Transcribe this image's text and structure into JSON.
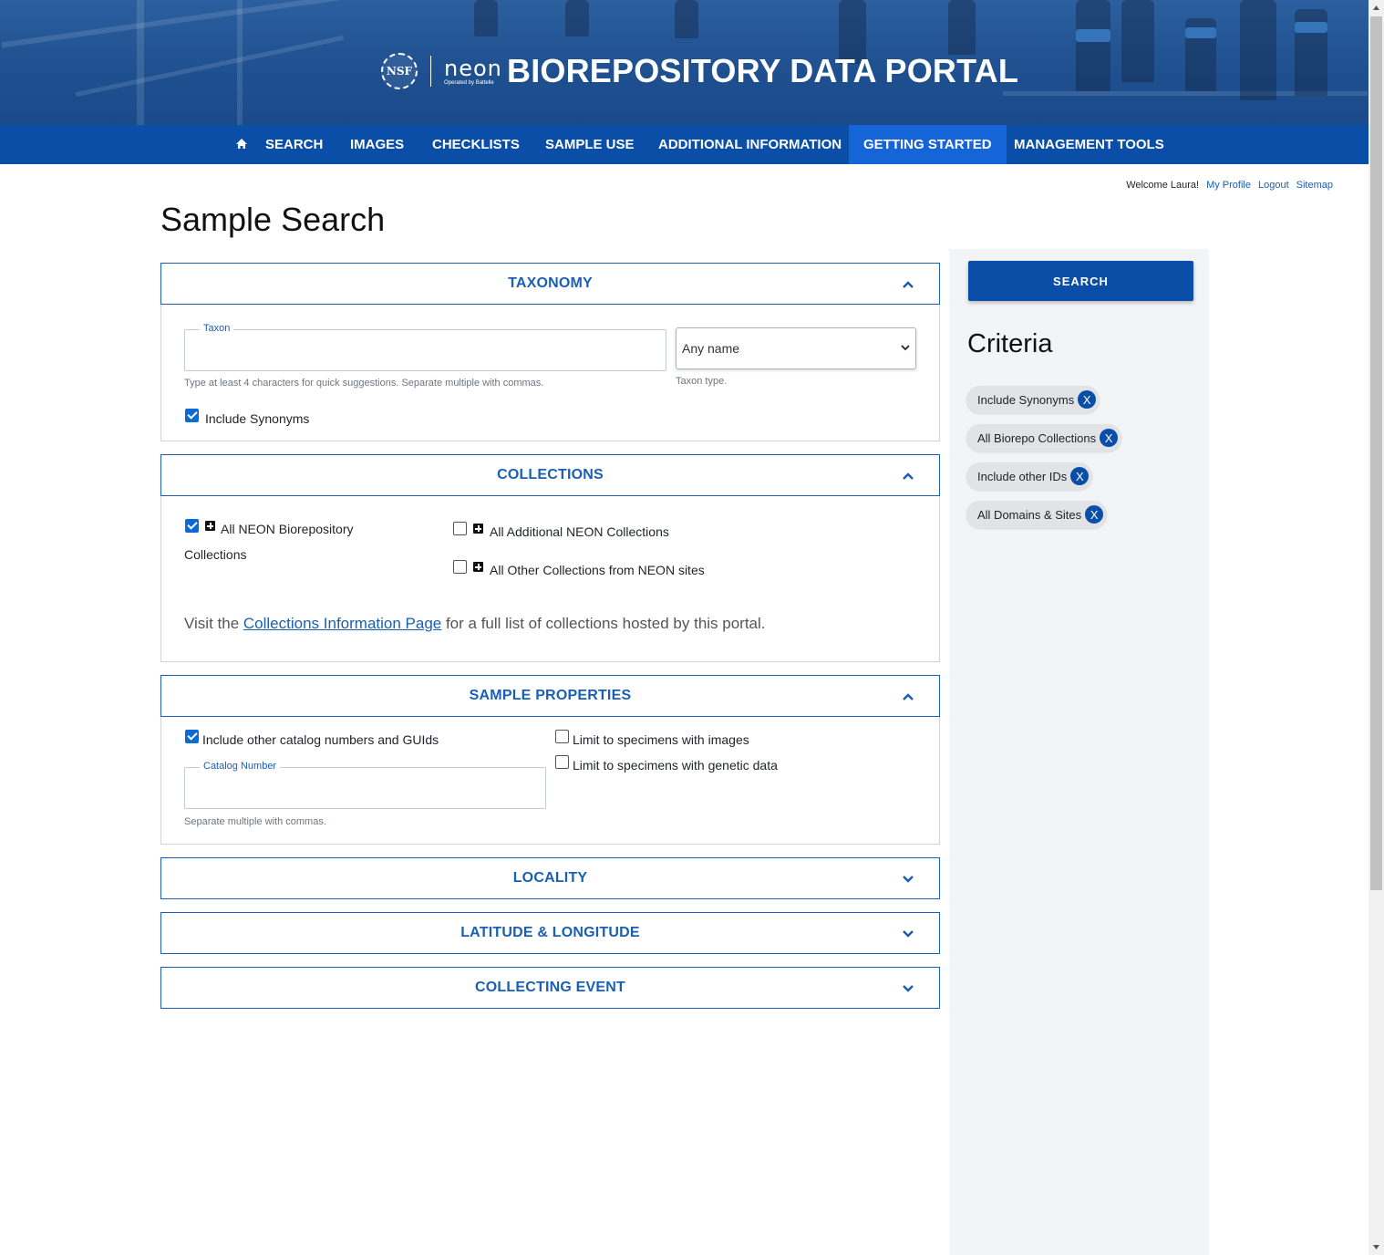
{
  "header": {
    "nsf_logo_text": "NSF",
    "neon_logo_text": "neon",
    "neon_logo_sub": "Operated by Battelle",
    "title": "BIOREPOSITORY DATA PORTAL"
  },
  "nav": {
    "home_icon": "home-icon",
    "items": [
      {
        "label": "SEARCH"
      },
      {
        "label": "IMAGES"
      },
      {
        "label": "CHECKLISTS"
      },
      {
        "label": "SAMPLE USE"
      },
      {
        "label": "ADDITIONAL INFORMATION"
      },
      {
        "label": "GETTING STARTED",
        "active": true
      },
      {
        "label": "MANAGEMENT TOOLS"
      }
    ]
  },
  "user": {
    "welcome": "Welcome Laura!",
    "profile": "My Profile",
    "logout": "Logout",
    "sitemap": "Sitemap"
  },
  "page_title": "Sample Search",
  "taxonomy": {
    "heading": "TAXONOMY",
    "taxon_legend": "Taxon",
    "taxon_value": "",
    "taxon_help": "Type at least 4 characters for quick suggestions. Separate multiple with commas.",
    "taxon_type_selected": "Any name",
    "taxon_type_help": "Taxon type.",
    "include_synonyms_label": "Include Synonyms",
    "include_synonyms_checked": true
  },
  "collections": {
    "heading": "COLLECTIONS",
    "all_neon_line1": "All NEON Biorepository",
    "all_neon_line2": "Collections",
    "all_additional": "All Additional NEON Collections",
    "all_other": "All Other Collections from NEON sites",
    "visit_prefix": "Visit the ",
    "visit_link": "Collections Information Page",
    "visit_suffix": " for a full list of collections hosted by this portal."
  },
  "sample_properties": {
    "heading": "SAMPLE PROPERTIES",
    "include_other_label": "Include other catalog numbers and GUIds",
    "catalog_legend": "Catalog Number",
    "catalog_help": "Separate multiple with commas.",
    "limit_images": "Limit to specimens with images",
    "limit_genetic": "Limit to specimens with genetic data"
  },
  "locality": {
    "heading": "LOCALITY"
  },
  "latlong": {
    "heading": "LATITUDE & LONGITUDE"
  },
  "collecting_event": {
    "heading": "COLLECTING EVENT"
  },
  "sidebar": {
    "search_button": "SEARCH",
    "criteria_title": "Criteria",
    "chips": [
      {
        "label": "Include Synonyms",
        "remove": "X"
      },
      {
        "label": "All Biorepo Collections",
        "remove": "X"
      },
      {
        "label": "Include other IDs",
        "remove": "X"
      },
      {
        "label": "All Domains & Sites",
        "remove": "X"
      }
    ]
  },
  "colors": {
    "nav_blue": "#0a4ea8",
    "nav_active": "#1565d8",
    "accent_blue": "#1a5fb4",
    "sidebar_bg": "#f3f4f6"
  }
}
